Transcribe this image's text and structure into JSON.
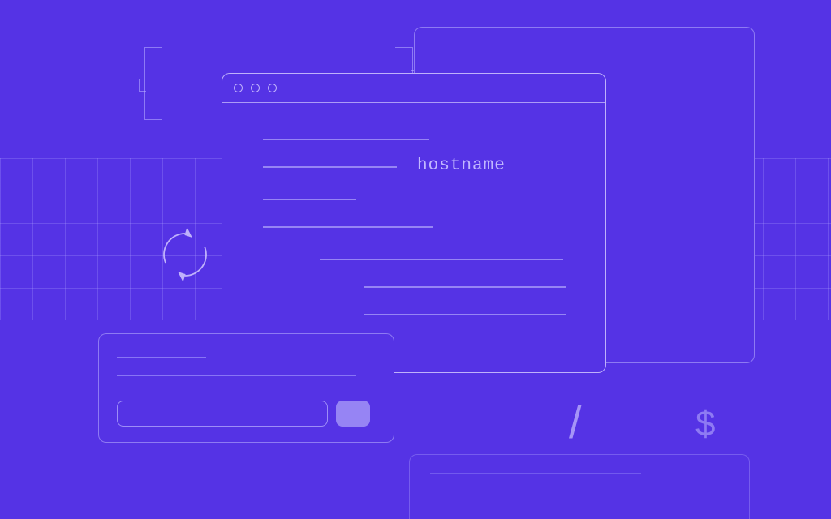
{
  "terminal": {
    "command": "hostname"
  },
  "glyphs": {
    "slash": "/",
    "dollar": "$"
  },
  "colors": {
    "background": "#5533E5",
    "accent": "#9684F4",
    "outline": "#C2B8FF"
  }
}
